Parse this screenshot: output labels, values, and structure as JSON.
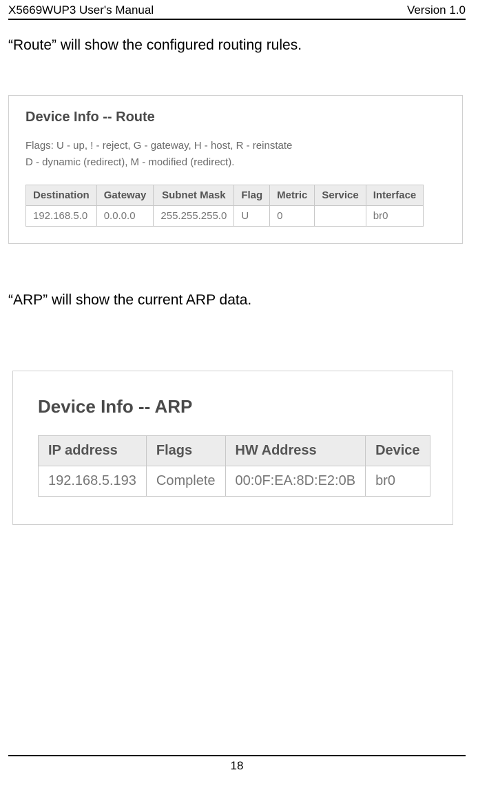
{
  "header": {
    "left": "X5669WUP3 User's Manual",
    "right": "Version 1.0"
  },
  "para1": "“Route” will show the configured routing rules.",
  "route_panel": {
    "title": "Device Info -- Route",
    "flags_line1": "Flags: U - up, ! - reject, G - gateway, H - host, R - reinstate",
    "flags_line2": "D - dynamic (redirect), M - modified (redirect).",
    "cols": [
      "Destination",
      "Gateway",
      "Subnet Mask",
      "Flag",
      "Metric",
      "Service",
      "Interface"
    ],
    "row": {
      "destination": "192.168.5.0",
      "gateway": "0.0.0.0",
      "subnet": "255.255.255.0",
      "flag": "U",
      "metric": "0",
      "service": "",
      "interface": "br0"
    }
  },
  "para2": "“ARP” will show the current ARP data.",
  "arp_panel": {
    "title": "Device Info -- ARP",
    "cols": [
      "IP address",
      "Flags",
      "HW Address",
      "Device"
    ],
    "row": {
      "ip": "192.168.5.193",
      "flags": "Complete",
      "hw": "00:0F:EA:8D:E2:0B",
      "device": "br0"
    }
  },
  "page_number": "18"
}
